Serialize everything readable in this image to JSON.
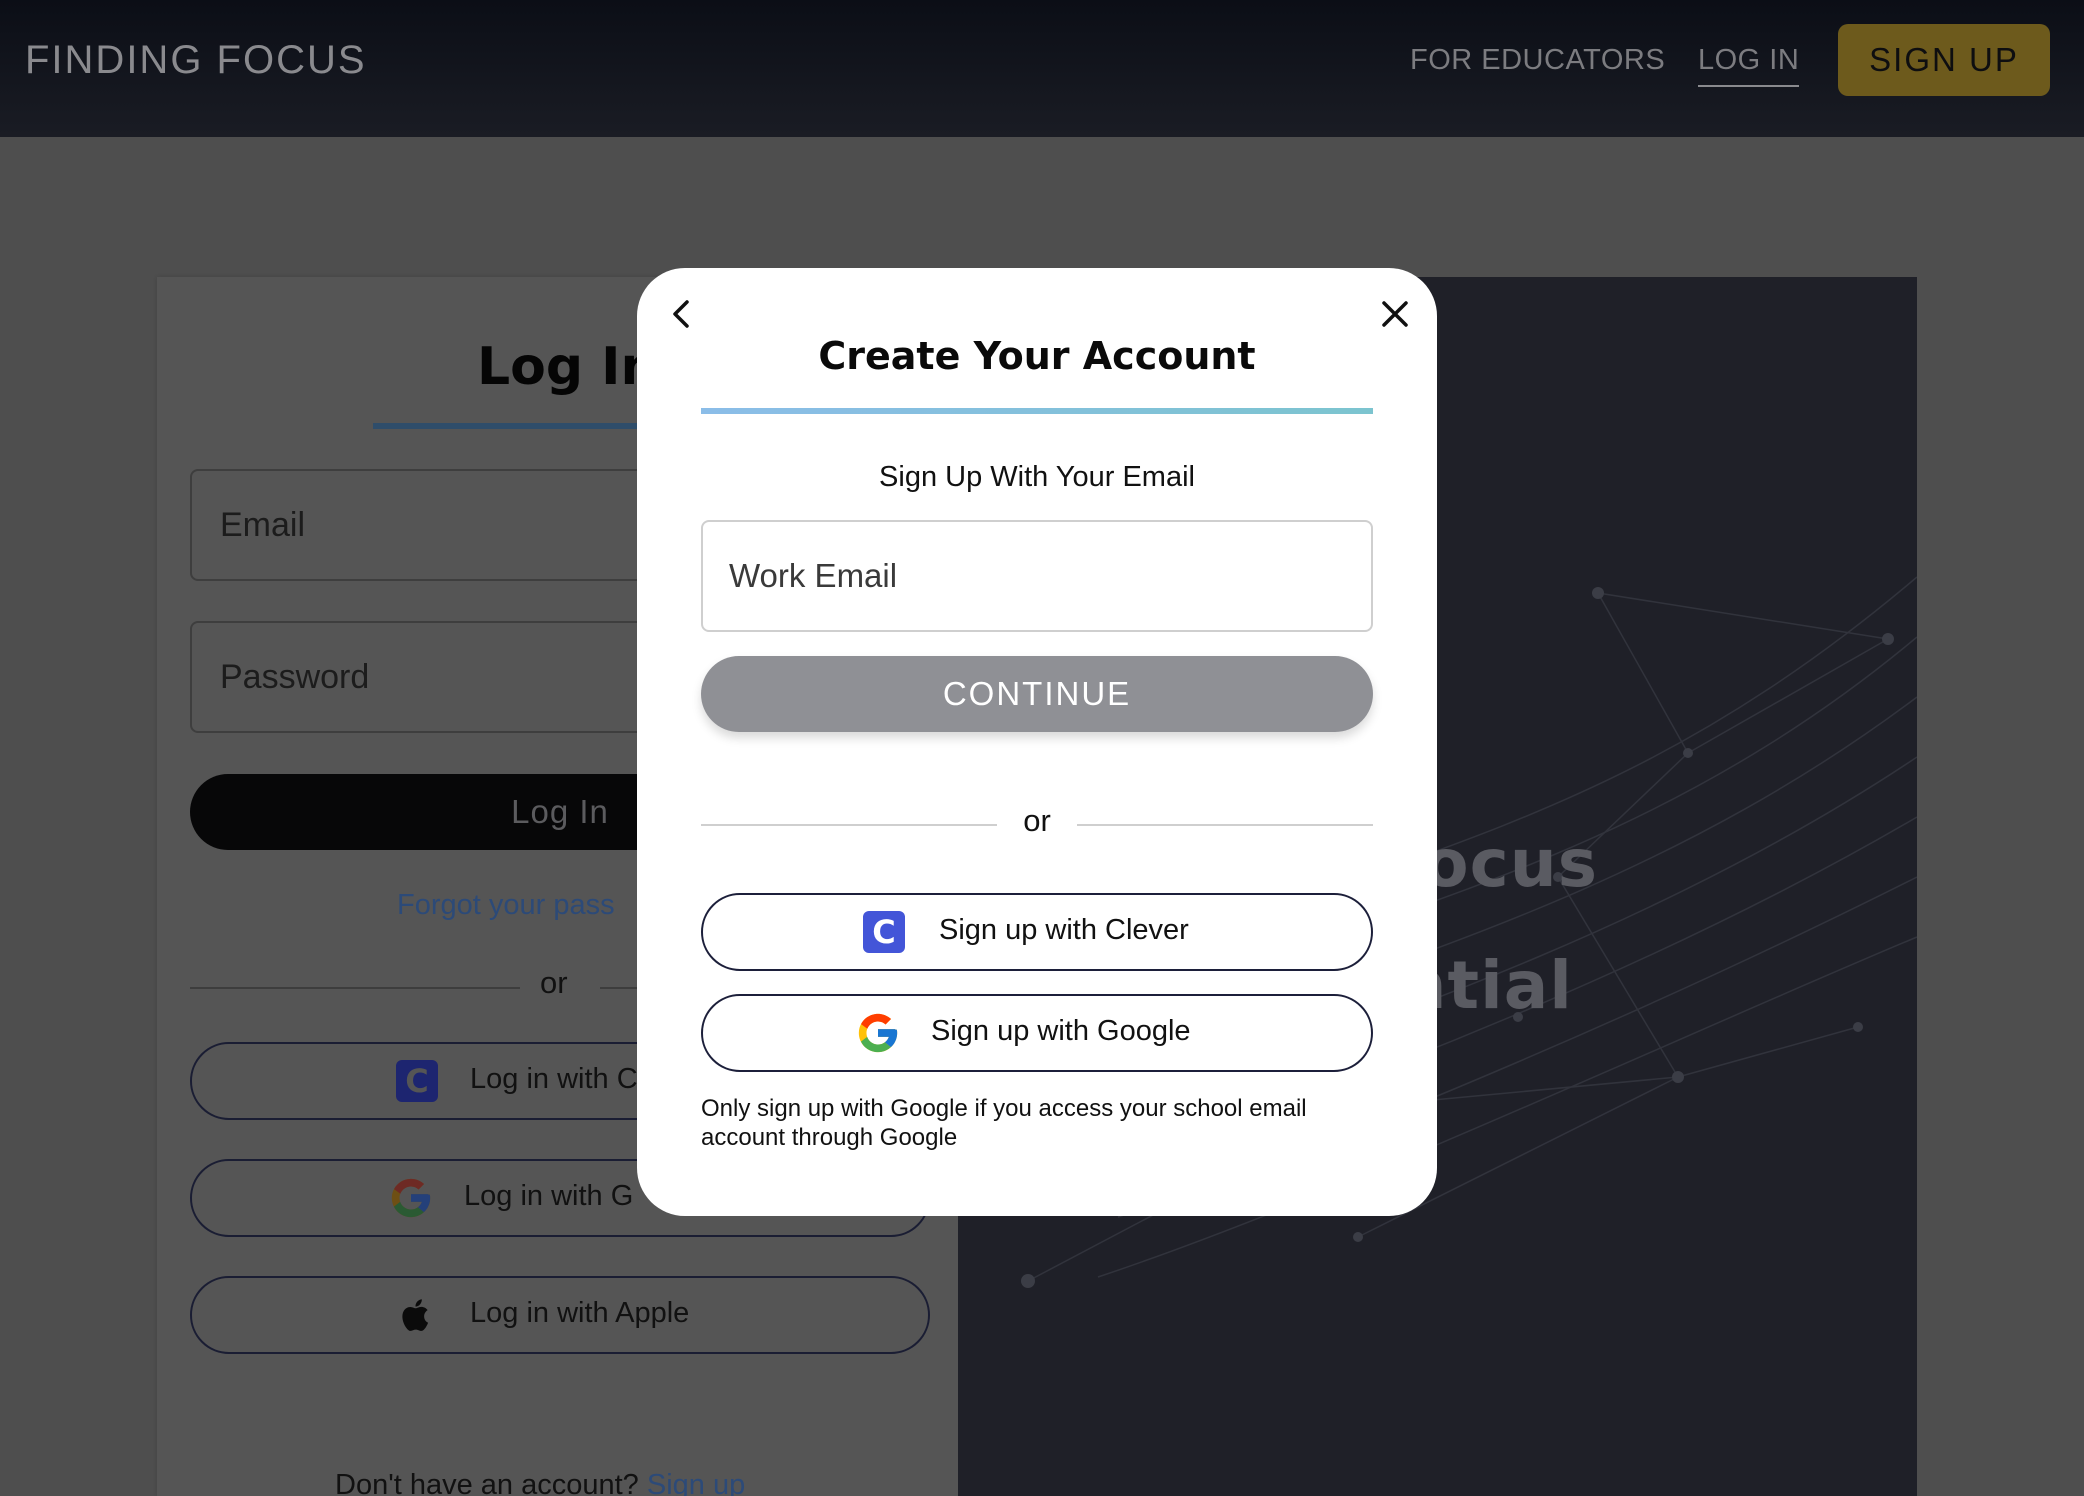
{
  "nav": {
    "brand": "FINDING FOCUS",
    "for_educators": "FOR EDUCATORS",
    "log_in": "LOG IN",
    "sign_up": "SIGN UP"
  },
  "login_card": {
    "title": "Log In",
    "email_placeholder": "Email",
    "password_placeholder": "Password",
    "login_button": "Log In",
    "forgot_link": "Forgot your pass",
    "or": "or",
    "clever_button": "Log in with C",
    "google_button": "Log in with G",
    "apple_button": "Log in with Apple",
    "no_account": "Don't have an account?",
    "sign_up_link": "Sign up"
  },
  "hero": {
    "line1": "our Focus",
    "line2": "r Potential"
  },
  "modal": {
    "title": "Create Your Account",
    "subtitle": "Sign Up With Your Email",
    "email_placeholder": "Work Email",
    "continue_button": "CONTINUE",
    "or": "or",
    "clever_button": "Sign up with Clever",
    "google_button": "Sign up with Google",
    "note": "Only sign up with Google if you access your school email account through Google"
  },
  "icons": {
    "back": "chevron-left-icon",
    "close": "close-icon",
    "clever": "clever-icon",
    "google": "google-icon",
    "apple": "apple-icon"
  },
  "colors": {
    "nav_bg": "#0b0e16",
    "signup_accent": "#6d5a1c",
    "modal_rule": "#8bbde8",
    "continue_bg": "#8f9095",
    "clever_blue": "#4355d8"
  }
}
